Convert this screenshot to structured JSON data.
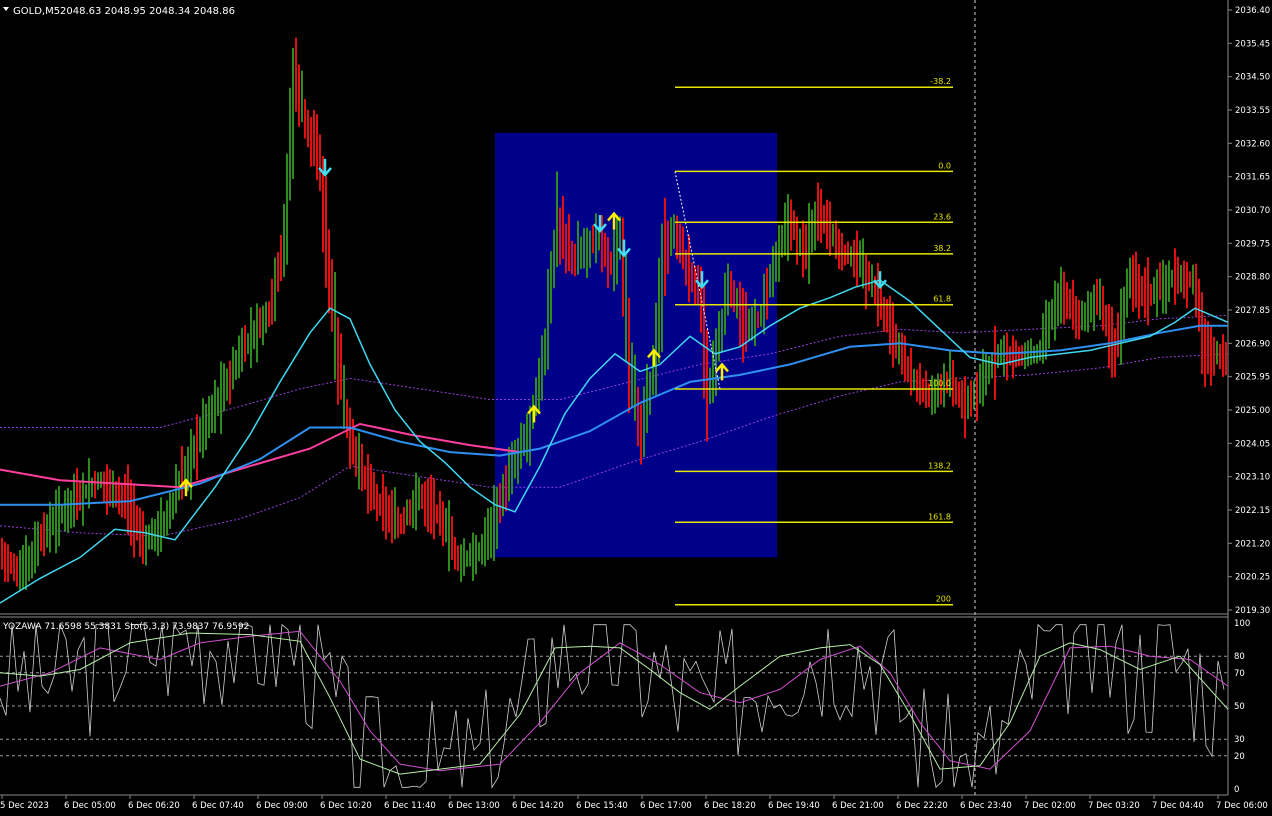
{
  "header": {
    "symbol": "GOLD,M5",
    "ohlc": "2048.63 2048.95 2048.34 2048.86"
  },
  "indicator": {
    "label": "YOZAWA 71.6598 55.3831  Sto(5,3,3) 73.9837 76.9592"
  },
  "colors": {
    "bull": "#2e8b1e",
    "bear": "#e01010",
    "ema_fast": "#40d8f0",
    "ema_slow": "#2f8ff0",
    "ema_long": "#ff3f9f",
    "envelope": "#9a40e0",
    "fib": "#e6e600",
    "zone": "#00008b",
    "arrow_up": "#ffee00",
    "arrow_down": "#40e0f0",
    "stoch_main": "#b8f0a8",
    "stoch_signal": "#d050d0",
    "yozawa": "#cfcfcf",
    "grid": "#8a8a8a"
  },
  "chart_data": [
    {
      "type": "candlestick",
      "title": "GOLD,M5",
      "y_ticks": [
        "2036.40",
        "2035.45",
        "2034.50",
        "2033.55",
        "2032.60",
        "2031.65",
        "2030.70",
        "2029.75",
        "2028.80",
        "2027.85",
        "2026.90",
        "2025.95",
        "2025.00",
        "2024.05",
        "2023.10",
        "2022.15",
        "2021.20",
        "2020.25",
        "2019.30"
      ],
      "ylim": [
        2019.2,
        2036.6
      ],
      "x_ticks": [
        "5 Dec 2023",
        "6 Dec 05:00",
        "6 Dec 06:20",
        "6 Dec 07:40",
        "6 Dec 09:00",
        "6 Dec 10:20",
        "6 Dec 11:40",
        "6 Dec 13:00",
        "6 Dec 14:20",
        "6 Dec 15:40",
        "6 Dec 17:00",
        "6 Dec 18:20",
        "6 Dec 19:40",
        "6 Dec 21:00",
        "6 Dec 22:20",
        "6 Dec 23:40",
        "7 Dec 02:00",
        "7 Dec 03:20",
        "7 Dec 04:40",
        "7 Dec 06:00"
      ],
      "price_path": [
        [
          0,
          2021
        ],
        [
          20,
          2020.3
        ],
        [
          45,
          2021.5
        ],
        [
          70,
          2022.3
        ],
        [
          100,
          2023
        ],
        [
          125,
          2022.5
        ],
        [
          145,
          2021.2
        ],
        [
          165,
          2021.8
        ],
        [
          185,
          2023.2
        ],
        [
          205,
          2024.6
        ],
        [
          225,
          2025.6
        ],
        [
          245,
          2026.8
        ],
        [
          270,
          2027.8
        ],
        [
          285,
          2030
        ],
        [
          295,
          2034.6
        ],
        [
          305,
          2033.4
        ],
        [
          320,
          2032
        ],
        [
          335,
          2027.2
        ],
        [
          350,
          2024.2
        ],
        [
          365,
          2023.1
        ],
        [
          380,
          2022.3
        ],
        [
          400,
          2021.7
        ],
        [
          420,
          2022.6
        ],
        [
          440,
          2022
        ],
        [
          460,
          2020.7
        ],
        [
          480,
          2020.9
        ],
        [
          500,
          2022.3
        ],
        [
          515,
          2023.5
        ],
        [
          530,
          2024.5
        ],
        [
          545,
          2026.6
        ],
        [
          557,
          2030.3
        ],
        [
          575,
          2029.3
        ],
        [
          590,
          2029.7
        ],
        [
          600,
          2030
        ],
        [
          610,
          2029.2
        ],
        [
          620,
          2029.7
        ],
        [
          630,
          2026.6
        ],
        [
          640,
          2024.2
        ],
        [
          655,
          2026.4
        ],
        [
          665,
          2029.4
        ],
        [
          675,
          2030.2
        ],
        [
          688,
          2029
        ],
        [
          700,
          2028.5
        ],
        [
          708,
          2025.3
        ],
        [
          718,
          2026.8
        ],
        [
          730,
          2028.6
        ],
        [
          745,
          2027.3
        ],
        [
          760,
          2027.6
        ],
        [
          775,
          2029.2
        ],
        [
          790,
          2030.4
        ],
        [
          805,
          2029.5
        ],
        [
          820,
          2030.7
        ],
        [
          840,
          2029.6
        ],
        [
          860,
          2029.2
        ],
        [
          880,
          2028.1
        ],
        [
          895,
          2027.1
        ],
        [
          910,
          2026
        ],
        [
          930,
          2025.4
        ],
        [
          950,
          2025.9
        ],
        [
          965,
          2025.1
        ],
        [
          980,
          2025.6
        ],
        [
          1000,
          2026.7
        ],
        [
          1020,
          2026.5
        ],
        [
          1040,
          2026.7
        ],
        [
          1060,
          2028.3
        ],
        [
          1080,
          2027.6
        ],
        [
          1100,
          2028.2
        ],
        [
          1115,
          2026.5
        ],
        [
          1130,
          2028.8
        ],
        [
          1150,
          2028.3
        ],
        [
          1170,
          2028.7
        ],
        [
          1195,
          2028.7
        ],
        [
          1205,
          2026.7
        ],
        [
          1228,
          2026.4
        ]
      ],
      "ema_fast_path": [
        [
          0,
          2019.5
        ],
        [
          40,
          2020.2
        ],
        [
          80,
          2020.8
        ],
        [
          115,
          2021.6
        ],
        [
          145,
          2021.5
        ],
        [
          175,
          2021.3
        ],
        [
          215,
          2022.8
        ],
        [
          250,
          2024.3
        ],
        [
          280,
          2025.8
        ],
        [
          310,
          2027.2
        ],
        [
          330,
          2027.9
        ],
        [
          350,
          2027.6
        ],
        [
          370,
          2026.3
        ],
        [
          395,
          2025
        ],
        [
          420,
          2024.1
        ],
        [
          445,
          2023.5
        ],
        [
          470,
          2022.8
        ],
        [
          495,
          2022.3
        ],
        [
          515,
          2022.1
        ],
        [
          540,
          2023.4
        ],
        [
          565,
          2024.9
        ],
        [
          590,
          2025.9
        ],
        [
          615,
          2026.6
        ],
        [
          640,
          2026.1
        ],
        [
          660,
          2026.3
        ],
        [
          690,
          2027.1
        ],
        [
          715,
          2026.6
        ],
        [
          740,
          2026.8
        ],
        [
          770,
          2027.4
        ],
        [
          800,
          2027.9
        ],
        [
          830,
          2028.2
        ],
        [
          855,
          2028.5
        ],
        [
          880,
          2028.7
        ],
        [
          910,
          2028.1
        ],
        [
          940,
          2027.3
        ],
        [
          970,
          2026.5
        ],
        [
          1000,
          2026.3
        ],
        [
          1030,
          2026.5
        ],
        [
          1060,
          2026.6
        ],
        [
          1090,
          2026.7
        ],
        [
          1120,
          2026.9
        ],
        [
          1150,
          2027.1
        ],
        [
          1175,
          2027.5
        ],
        [
          1195,
          2027.9
        ],
        [
          1228,
          2027.5
        ]
      ],
      "ema_slow_path": [
        [
          0,
          2022.3
        ],
        [
          60,
          2022.3
        ],
        [
          130,
          2022.4
        ],
        [
          200,
          2022.9
        ],
        [
          260,
          2023.6
        ],
        [
          310,
          2024.5
        ],
        [
          350,
          2024.5
        ],
        [
          400,
          2024.1
        ],
        [
          450,
          2023.8
        ],
        [
          500,
          2023.7
        ],
        [
          540,
          2023.9
        ],
        [
          590,
          2024.4
        ],
        [
          640,
          2025.2
        ],
        [
          690,
          2025.8
        ],
        [
          740,
          2026
        ],
        [
          790,
          2026.3
        ],
        [
          850,
          2026.8
        ],
        [
          900,
          2026.9
        ],
        [
          950,
          2026.7
        ],
        [
          1000,
          2026.6
        ],
        [
          1060,
          2026.7
        ],
        [
          1110,
          2026.9
        ],
        [
          1160,
          2027.2
        ],
        [
          1200,
          2027.4
        ],
        [
          1228,
          2027.4
        ]
      ],
      "ema_long_path": [
        [
          0,
          2023.3
        ],
        [
          60,
          2023
        ],
        [
          120,
          2022.9
        ],
        [
          180,
          2022.8
        ],
        [
          250,
          2023.4
        ],
        [
          310,
          2023.9
        ],
        [
          360,
          2024.6
        ],
        [
          410,
          2024.3
        ],
        [
          470,
          2024
        ],
        [
          520,
          2023.8
        ]
      ],
      "envelope_upper_path": [
        [
          0,
          2024.5
        ],
        [
          80,
          2024.5
        ],
        [
          160,
          2024.5
        ],
        [
          240,
          2025.1
        ],
        [
          300,
          2025.6
        ],
        [
          350,
          2025.9
        ],
        [
          420,
          2025.6
        ],
        [
          490,
          2025.3
        ],
        [
          560,
          2025.3
        ],
        [
          630,
          2025.8
        ],
        [
          700,
          2026.3
        ],
        [
          770,
          2026.6
        ],
        [
          840,
          2027.1
        ],
        [
          900,
          2027.3
        ],
        [
          960,
          2027.2
        ],
        [
          1030,
          2027.3
        ],
        [
          1100,
          2027.4
        ],
        [
          1160,
          2027.6
        ],
        [
          1228,
          2027.7
        ]
      ],
      "envelope_lower_path": [
        [
          0,
          2021.7
        ],
        [
          80,
          2021.5
        ],
        [
          160,
          2021.4
        ],
        [
          240,
          2021.9
        ],
        [
          300,
          2022.5
        ],
        [
          350,
          2023.4
        ],
        [
          420,
          2023.1
        ],
        [
          490,
          2022.8
        ],
        [
          560,
          2022.8
        ],
        [
          630,
          2023.5
        ],
        [
          700,
          2024.1
        ],
        [
          770,
          2024.8
        ],
        [
          840,
          2025.4
        ],
        [
          900,
          2025.8
        ],
        [
          960,
          2025.9
        ],
        [
          1030,
          2026
        ],
        [
          1100,
          2026.2
        ],
        [
          1160,
          2026.5
        ],
        [
          1228,
          2026.6
        ]
      ],
      "signals": [
        {
          "type": "up",
          "x": 186,
          "price": 2022.8
        },
        {
          "type": "down",
          "x": 325,
          "price": 2031.9
        },
        {
          "type": "up",
          "x": 534,
          "price": 2024.9
        },
        {
          "type": "down",
          "x": 600,
          "price": 2030.3
        },
        {
          "type": "up",
          "x": 614,
          "price": 2030.4
        },
        {
          "type": "down",
          "x": 624,
          "price": 2029.6
        },
        {
          "type": "up",
          "x": 654,
          "price": 2026.5
        },
        {
          "type": "down",
          "x": 702,
          "price": 2028.7
        },
        {
          "type": "up",
          "x": 722,
          "price": 2026.1
        },
        {
          "type": "down",
          "x": 880,
          "price": 2028.7
        }
      ],
      "zone": {
        "x_start": 495,
        "x_end": 777,
        "price_top": 2032.9,
        "price_bottom": 2020.8
      },
      "fibonacci": {
        "x_start": 675,
        "x_end": 953,
        "anchor_price_high": 2031.8,
        "anchor_price_low": 2025.6,
        "levels": [
          {
            "label": "-38.2",
            "price": 2034.2
          },
          {
            "label": "0.0",
            "price": 2031.8
          },
          {
            "label": "23.6",
            "price": 2030.35
          },
          {
            "label": "38.2",
            "price": 2029.45
          },
          {
            "label": "61.8",
            "price": 2028.0
          },
          {
            "label": "100.0",
            "price": 2025.6
          },
          {
            "label": "138.2",
            "price": 2023.25
          },
          {
            "label": "161.8",
            "price": 2021.8
          },
          {
            "label": "200",
            "price": 2019.45
          }
        ]
      },
      "period_separator_x": 975
    },
    {
      "type": "line",
      "title": "YOZAWA / Sto(5,3,3)",
      "y_ticks": [
        "100",
        "80",
        "70",
        "50",
        "30",
        "20",
        "0"
      ],
      "levels": [
        80,
        70,
        50,
        30,
        20
      ],
      "ylim": [
        0,
        100
      ],
      "stoch_main_path": [
        [
          0,
          70
        ],
        [
          40,
          68
        ],
        [
          80,
          72
        ],
        [
          130,
          88
        ],
        [
          190,
          94
        ],
        [
          250,
          93
        ],
        [
          300,
          89
        ],
        [
          330,
          55
        ],
        [
          360,
          18
        ],
        [
          400,
          9
        ],
        [
          440,
          12
        ],
        [
          480,
          15
        ],
        [
          520,
          45
        ],
        [
          555,
          85
        ],
        [
          590,
          86
        ],
        [
          620,
          85
        ],
        [
          650,
          72
        ],
        [
          680,
          58
        ],
        [
          710,
          48
        ],
        [
          740,
          62
        ],
        [
          780,
          80
        ],
        [
          820,
          85
        ],
        [
          850,
          87
        ],
        [
          880,
          75
        ],
        [
          910,
          45
        ],
        [
          940,
          12
        ],
        [
          980,
          14
        ],
        [
          1010,
          40
        ],
        [
          1040,
          80
        ],
        [
          1070,
          88
        ],
        [
          1100,
          84
        ],
        [
          1140,
          72
        ],
        [
          1180,
          80
        ],
        [
          1228,
          48
        ]
      ],
      "stoch_signal_path": [
        [
          0,
          62
        ],
        [
          50,
          70
        ],
        [
          100,
          85
        ],
        [
          160,
          78
        ],
        [
          200,
          88
        ],
        [
          250,
          92
        ],
        [
          300,
          95
        ],
        [
          340,
          65
        ],
        [
          370,
          35
        ],
        [
          400,
          15
        ],
        [
          440,
          11
        ],
        [
          500,
          15
        ],
        [
          540,
          40
        ],
        [
          580,
          70
        ],
        [
          620,
          88
        ],
        [
          660,
          75
        ],
        [
          700,
          58
        ],
        [
          740,
          52
        ],
        [
          780,
          60
        ],
        [
          820,
          78
        ],
        [
          860,
          86
        ],
        [
          890,
          70
        ],
        [
          920,
          40
        ],
        [
          950,
          17
        ],
        [
          990,
          12
        ],
        [
          1030,
          35
        ],
        [
          1070,
          85
        ],
        [
          1110,
          86
        ],
        [
          1150,
          80
        ],
        [
          1190,
          78
        ],
        [
          1228,
          62
        ]
      ]
    }
  ]
}
